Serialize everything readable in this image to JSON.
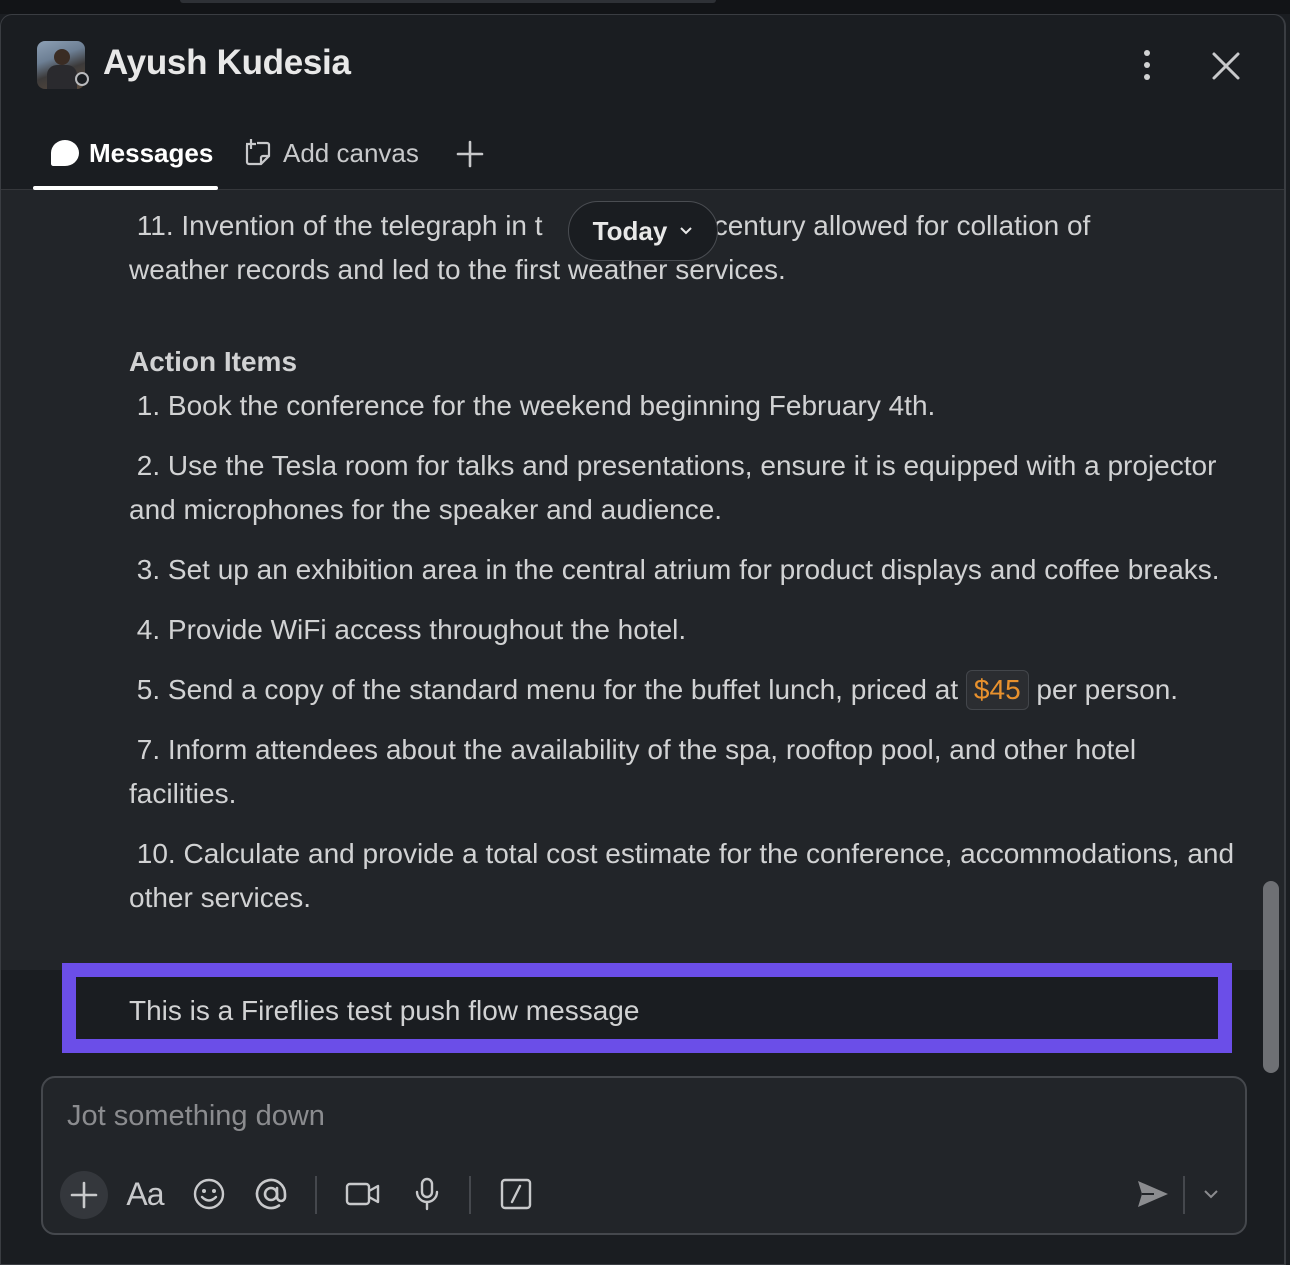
{
  "header": {
    "name": "Ayush Kudesia"
  },
  "tabs": {
    "messages": "Messages",
    "canvas": "Add canvas"
  },
  "date_divider": "Today",
  "message": {
    "item11_a": "11. Invention of the telegraph in t",
    "item11_b": "th century allowed for collation of",
    "item11_c": "weather records and led to the first weather services.",
    "action_heading": "Action Items",
    "items": [
      "1. Book the conference for the weekend beginning February 4th.",
      "2. Use the Tesla room for talks and presentations, ensure it is equipped with a projector and microphones for the speaker and audience.",
      "3. Set up an exhibition area in the central atrium for product displays and coffee breaks.",
      "4. Provide WiFi access throughout the hotel."
    ],
    "item5_prefix": "5. Send a copy of the standard menu for the buffet lunch, priced at",
    "item5_price": "$45",
    "item5_suffix": "per person.",
    "items_after": [
      "7. Inform attendees about the availability of the spa, rooftop pool, and other hotel facilities.",
      "10. Calculate and provide a total cost estimate for the conference, accommodations, and other services."
    ]
  },
  "push_message": "This is a Fireflies test push flow message",
  "composer": {
    "placeholder": "Jot something down",
    "format_label": "Aa"
  },
  "colors": {
    "highlight_border": "#6b4ee8",
    "price_text": "#e8912d"
  }
}
